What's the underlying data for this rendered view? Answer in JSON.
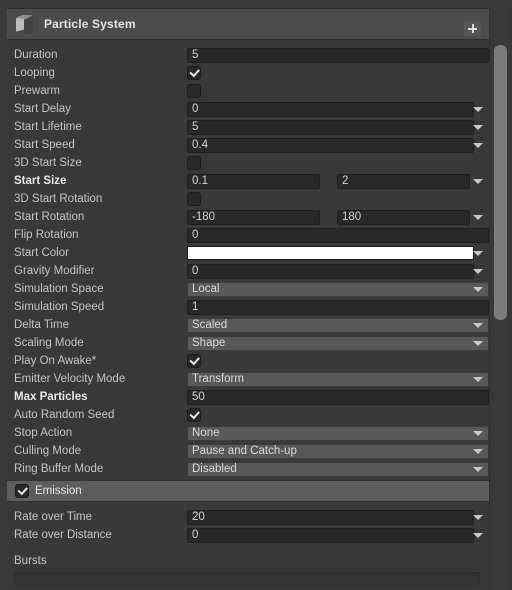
{
  "window": {
    "background": "#383838",
    "accent_marker": "#2f80d8"
  },
  "component": {
    "title": "Particle System",
    "icon": "particle-system-icon",
    "add_button_label": "+"
  },
  "main": {
    "rows": [
      {
        "label": "Duration",
        "type": "field",
        "value": "5",
        "bold": false,
        "marker": false,
        "dropdown": false,
        "width": "wide"
      },
      {
        "label": "Looping",
        "type": "checkbox",
        "value": "",
        "checked": true,
        "bold": false,
        "marker": false
      },
      {
        "label": "Prewarm",
        "type": "checkbox",
        "value": "",
        "checked": false,
        "bold": false,
        "marker": false
      },
      {
        "label": "Start Delay",
        "type": "field",
        "value": "0",
        "bold": false,
        "marker": false,
        "dropdown": true,
        "width": "narrow"
      },
      {
        "label": "Start Lifetime",
        "type": "field",
        "value": "5",
        "bold": false,
        "marker": false,
        "dropdown": true,
        "width": "narrow"
      },
      {
        "label": "Start Speed",
        "type": "field",
        "value": "0.4",
        "bold": false,
        "marker": false,
        "dropdown": true,
        "width": "narrow"
      },
      {
        "label": "3D Start Size",
        "type": "checkbox",
        "value": "",
        "checked": false,
        "bold": false,
        "marker": false
      },
      {
        "label": "Start Size",
        "type": "field2",
        "value": "0.1",
        "value2": "2",
        "bold": true,
        "marker": true,
        "dropdown": true
      },
      {
        "label": "3D Start Rotation",
        "type": "checkbox",
        "value": "",
        "checked": false,
        "bold": false,
        "marker": false
      },
      {
        "label": "Start Rotation",
        "type": "field2",
        "value": "-180",
        "value2": "180",
        "bold": false,
        "marker": false,
        "dropdown": true
      },
      {
        "label": "Flip Rotation",
        "type": "field",
        "value": "0",
        "bold": false,
        "marker": false,
        "dropdown": false,
        "width": "wide"
      },
      {
        "label": "Start Color",
        "type": "color",
        "value": "#ffffff",
        "bold": false,
        "marker": false,
        "dropdown": true
      },
      {
        "label": "Gravity Modifier",
        "type": "field",
        "value": "0",
        "bold": false,
        "marker": false,
        "dropdown": true,
        "width": "narrow"
      },
      {
        "label": "Simulation Space",
        "type": "popup",
        "value": "Local",
        "bold": false,
        "marker": false
      },
      {
        "label": "Simulation Speed",
        "type": "field",
        "value": "1",
        "bold": false,
        "marker": false,
        "dropdown": false,
        "width": "wide"
      },
      {
        "label": "Delta Time",
        "type": "popup",
        "value": "Scaled",
        "bold": false,
        "marker": false
      },
      {
        "label": "Scaling Mode",
        "type": "popup",
        "value": "Shape",
        "bold": false,
        "marker": false
      },
      {
        "label": "Play On Awake*",
        "type": "checkbox",
        "value": "",
        "checked": true,
        "bold": false,
        "marker": false
      },
      {
        "label": "Emitter Velocity Mode",
        "type": "popup",
        "value": "Transform",
        "bold": false,
        "marker": false
      },
      {
        "label": "Max Particles",
        "type": "field",
        "value": "50",
        "bold": true,
        "marker": true,
        "dropdown": false,
        "width": "wide"
      },
      {
        "label": "Auto Random Seed",
        "type": "checkbox",
        "value": "",
        "checked": true,
        "bold": false,
        "marker": false
      },
      {
        "label": "Stop Action",
        "type": "popup",
        "value": "None",
        "bold": false,
        "marker": false
      },
      {
        "label": "Culling Mode",
        "type": "popup",
        "value": "Pause and Catch-up",
        "bold": false,
        "marker": false
      },
      {
        "label": "Ring Buffer Mode",
        "type": "popup",
        "value": "Disabled",
        "bold": false,
        "marker": false
      }
    ]
  },
  "emission": {
    "title": "Emission",
    "enabled": true,
    "rows": [
      {
        "label": "Rate over Time",
        "type": "field",
        "value": "20",
        "dropdown": true,
        "width": "narrow"
      },
      {
        "label": "Rate over Distance",
        "type": "field",
        "value": "0",
        "dropdown": true,
        "width": "narrow"
      }
    ],
    "bursts_label": "Bursts"
  }
}
